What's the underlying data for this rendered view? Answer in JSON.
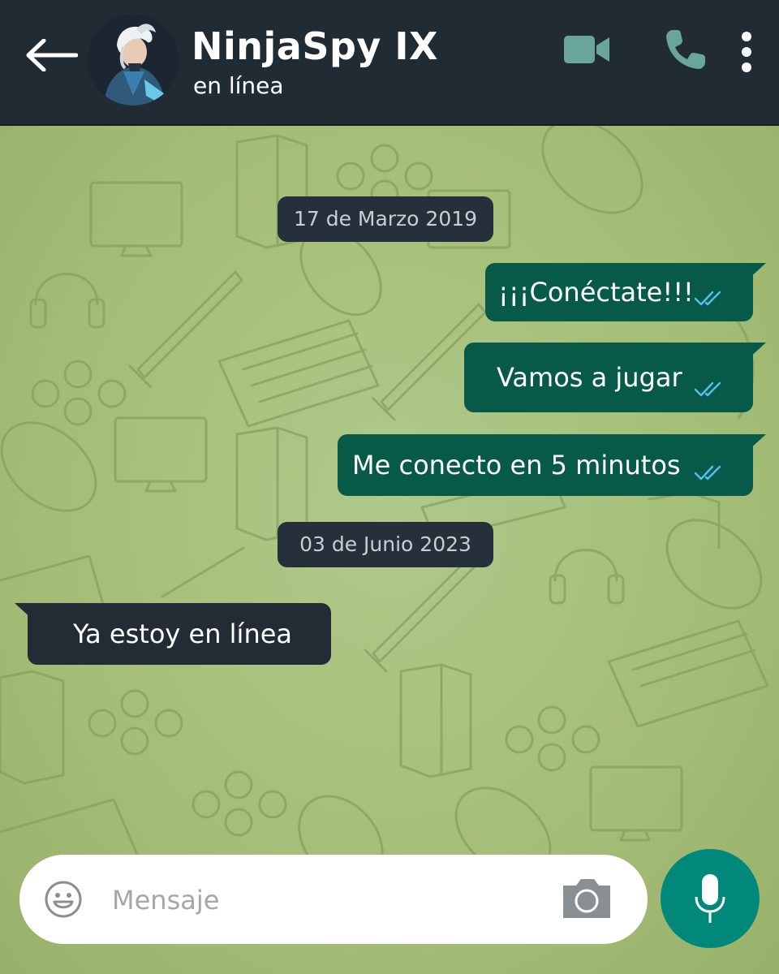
{
  "header": {
    "contact_name": "NinjaSpy IX",
    "status": "en línea",
    "icons": [
      "back-arrow-icon",
      "video-call-icon",
      "phone-icon",
      "more-options-icon"
    ]
  },
  "chat": {
    "dates": [
      "17 de Marzo 2019",
      "03 de Junio 2023"
    ],
    "messages": [
      {
        "text": "¡¡¡Conéctate!!!",
        "direction": "outgoing",
        "status": "read"
      },
      {
        "text": "Vamos a jugar",
        "direction": "outgoing",
        "status": "read"
      },
      {
        "text": "Me conecto en 5 minutos",
        "direction": "outgoing",
        "status": "read"
      },
      {
        "text": "Ya estoy en línea",
        "direction": "incoming"
      }
    ]
  },
  "composer": {
    "placeholder": "Mensaje",
    "icons": [
      "emoji-icon",
      "camera-icon",
      "microphone-icon"
    ]
  },
  "colors": {
    "header_bg": "#212b34",
    "chat_bg": "#a8c079",
    "outgoing_bubble": "#075a48",
    "incoming_bubble": "#232c35",
    "read_ticks": "#53bdeb",
    "accent": "#00897b",
    "header_icons": "#6aa59b"
  }
}
